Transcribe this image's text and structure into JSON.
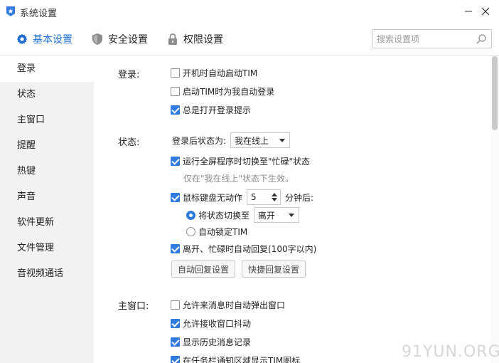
{
  "window": {
    "title": "系统设置",
    "minimize": "—",
    "close": "✕"
  },
  "tabs": [
    {
      "label": "基本设置",
      "icon": "gear-icon"
    },
    {
      "label": "安全设置",
      "icon": "shield-icon"
    },
    {
      "label": "权限设置",
      "icon": "lock-icon"
    }
  ],
  "search": {
    "placeholder": "搜索设置项",
    "value": ""
  },
  "sidebar": {
    "items": [
      {
        "label": "登录"
      },
      {
        "label": "状态"
      },
      {
        "label": "主窗口"
      },
      {
        "label": "提醒"
      },
      {
        "label": "热键"
      },
      {
        "label": "声音"
      },
      {
        "label": "软件更新"
      },
      {
        "label": "文件管理"
      },
      {
        "label": "音视频通话"
      }
    ]
  },
  "login": {
    "label": "登录:",
    "auto_start": {
      "label": "开机时自动启动TIM",
      "checked": false
    },
    "auto_login": {
      "label": "启动TIM时为我自动登录",
      "checked": false
    },
    "login_tip": {
      "label": "总是打开登录提示",
      "checked": true
    }
  },
  "status": {
    "label": "状态:",
    "after_login_label": "登录后状态为:",
    "after_login_value": "我在线上",
    "fullscreen_busy": {
      "label": "运行全屏程序时切换至\"忙碌\"状态",
      "checked": true
    },
    "fullscreen_hint": "仅在\"我在线上\"状态下生效。",
    "idle": {
      "label": "鼠标键盘无动作",
      "checked": true,
      "minutes": "5",
      "suffix": "分钟后:"
    },
    "switch_to": {
      "label": "将状态切换至",
      "value": "离开",
      "selected": true
    },
    "auto_lock": {
      "label": "自动锁定TIM",
      "selected": false
    },
    "auto_reply": {
      "label": "离开、忙碌时自动回复(100字以内)",
      "checked": true
    },
    "auto_reply_btn": "自动回复设置",
    "quick_reply_btn": "快捷回复设置"
  },
  "main_window": {
    "label": "主窗口:",
    "popup": {
      "label": "允许来消息时自动弹出窗口",
      "checked": false
    },
    "shake": {
      "label": "允许接收窗口抖动",
      "checked": true
    },
    "history": {
      "label": "显示历史消息记录",
      "checked": true
    },
    "tray": {
      "label": "在任务栏通知区域显示TIM图标",
      "checked": true
    }
  },
  "scroll": {
    "position": 0
  },
  "watermark": "91YUN.ORG",
  "colors": {
    "accent": "#1f6fd6",
    "checkbox": "#2f7be0",
    "sidebar_bg": "#f2f2f2"
  }
}
